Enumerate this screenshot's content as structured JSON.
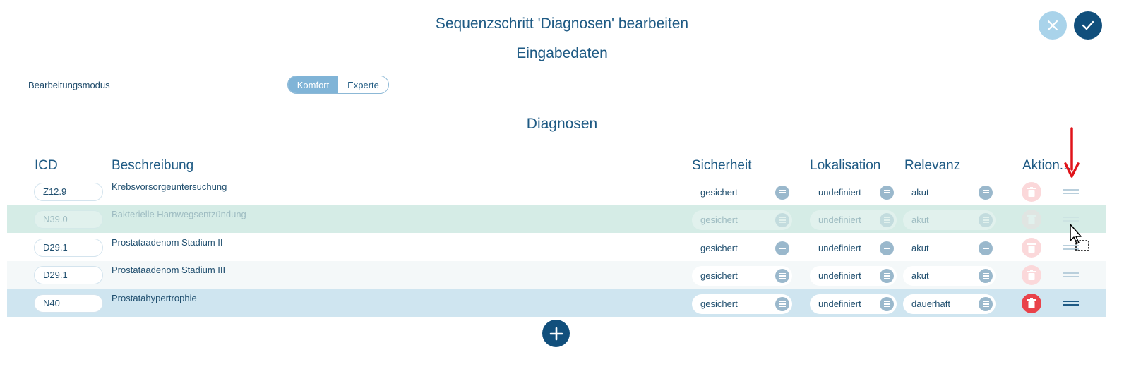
{
  "dialog": {
    "title": "Sequenzschritt 'Diagnosen' bearbeiten",
    "subtitle": "Eingabedaten",
    "cancel_icon": "close-icon",
    "confirm_icon": "check-icon"
  },
  "mode": {
    "label": "Bearbeitungsmodus",
    "options": [
      "Komfort",
      "Experte"
    ],
    "selected": "Komfort"
  },
  "section": {
    "title": "Diagnosen"
  },
  "table": {
    "headers": {
      "icd": "ICD",
      "description": "Beschreibung",
      "certainty": "Sicherheit",
      "localization": "Lokalisation",
      "relevance": "Relevanz",
      "actions": "Aktion..."
    },
    "rows": [
      {
        "icd": "Z12.9",
        "description": "Krebsvorsorgeuntersuchung",
        "certainty": "gesichert",
        "localization": "undefiniert",
        "relevance": "akut"
      },
      {
        "icd": "N39.0",
        "description": "Bakterielle Harnwegsentzündung",
        "certainty": "gesichert",
        "localization": "undefiniert",
        "relevance": "akut"
      },
      {
        "icd": "D29.1",
        "description": "Prostataadenom Stadium II",
        "certainty": "gesichert",
        "localization": "undefiniert",
        "relevance": "akut"
      },
      {
        "icd": "D29.1",
        "description": "Prostataadenom Stadium III",
        "certainty": "gesichert",
        "localization": "undefiniert",
        "relevance": "akut"
      },
      {
        "icd": "N40",
        "description": "Prostatahypertrophie",
        "certainty": "gesichert",
        "localization": "undefiniert",
        "relevance": "dauerhaft"
      }
    ]
  },
  "colors": {
    "accent": "#114f7c",
    "ghost_row": "#d5ece6",
    "selected_row": "#cfe5f0",
    "alt_row": "#f4f8f9",
    "delete": "#e9424a",
    "annotation_arrow": "#e0141a"
  }
}
